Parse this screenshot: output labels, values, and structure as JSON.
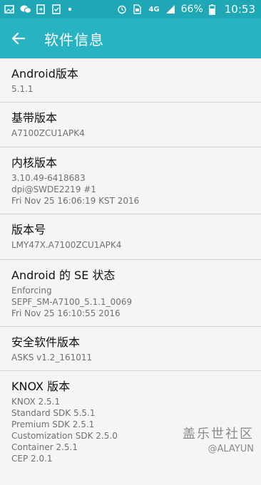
{
  "status_bar": {
    "network": "4G",
    "battery": "66%",
    "time": "10:53"
  },
  "app_bar": {
    "title": "软件信息"
  },
  "items": [
    {
      "title": "Android版本",
      "lines": [
        "5.1.1"
      ]
    },
    {
      "title": "基带版本",
      "lines": [
        "A7100ZCU1APK4"
      ]
    },
    {
      "title": "内核版本",
      "lines": [
        "3.10.49-6418683",
        "dpi@SWDE2219 #1",
        "Fri Nov 25 16:06:19 KST 2016"
      ]
    },
    {
      "title": "版本号",
      "lines": [
        "LMY47X.A7100ZCU1APK4"
      ]
    },
    {
      "title": "Android 的 SE 状态",
      "lines": [
        "Enforcing",
        "SEPF_SM-A7100_5.1.1_0069",
        "Fri Nov 25 16:10:55 2016"
      ]
    },
    {
      "title": "安全软件版本",
      "lines": [
        "ASKS v1.2_161011"
      ]
    },
    {
      "title": "KNOX 版本",
      "lines": [
        "KNOX 2.5.1",
        "Standard SDK 5.5.1",
        "Premium SDK 2.5.1",
        "Customization SDK 2.5.0",
        "Container 2.5.1",
        "CEP 2.0.1"
      ]
    }
  ],
  "watermark": {
    "main": "盖乐世社区",
    "sub": "@ALAYUN"
  }
}
